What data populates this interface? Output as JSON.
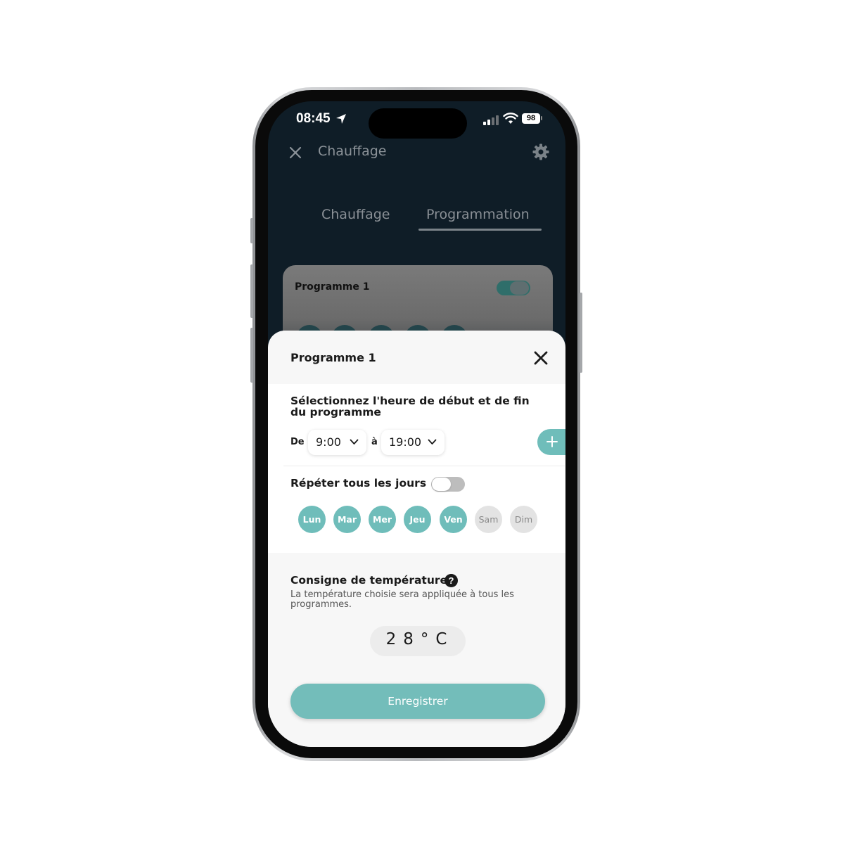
{
  "status_bar": {
    "time": "08:45",
    "battery": "98"
  },
  "header": {
    "title": "Chauffage"
  },
  "tabs": [
    {
      "label": "Chauffage"
    },
    {
      "label": "Programmation",
      "active": true
    }
  ],
  "background_card": {
    "title": "Programme 1",
    "enabled": true
  },
  "sheet": {
    "title": "Programme 1",
    "time_section": {
      "heading": "Sélectionnez l'heure de début et de fin du programme",
      "from_label": "De",
      "start_time": "9:00",
      "to_label": "à",
      "end_time": "19:00"
    },
    "repeat": {
      "label": "Répéter tous les jours",
      "enabled": false
    },
    "days": [
      {
        "label": "Lun",
        "selected": true
      },
      {
        "label": "Mar",
        "selected": true
      },
      {
        "label": "Mer",
        "selected": true
      },
      {
        "label": "Jeu",
        "selected": true
      },
      {
        "label": "Ven",
        "selected": true
      },
      {
        "label": "Sam",
        "selected": false
      },
      {
        "label": "Dim",
        "selected": false
      }
    ],
    "temperature": {
      "title": "Consigne de température",
      "description": "La température choisie sera appliquée à tous les programmes.",
      "value": "28°C"
    },
    "save_label": "Enregistrer"
  },
  "colors": {
    "accent": "#6fbdba",
    "dark_background": "#0f1d27"
  }
}
